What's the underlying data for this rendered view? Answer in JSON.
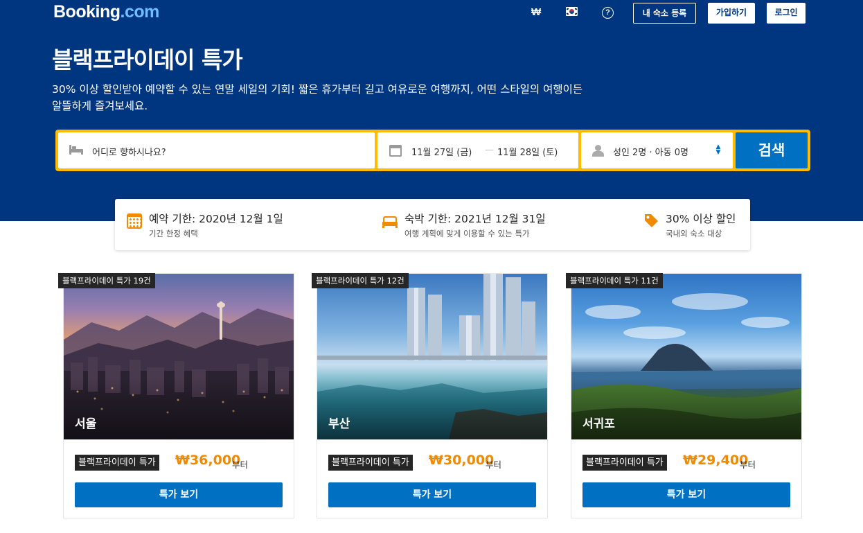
{
  "header": {
    "logo_main": "Booking",
    "logo_suffix": ".com",
    "currency": "₩",
    "help_glyph": "?",
    "list_property_label": "내 숙소 등록",
    "signup_label": "가입하기",
    "login_label": "로그인"
  },
  "hero": {
    "title": "블랙프라이데이 특가",
    "subtitle": "30% 이상 할인받아 예약할 수 있는 연말 세일의 기회! 짧은 휴가부터 길고 여유로운 여행까지, 어떤 스타일의 여행이든 알뜰하게 즐겨보세요."
  },
  "search": {
    "destination_placeholder": "어디로 향하시나요?",
    "checkin": "11월 27일 (금)",
    "date_separator": "—",
    "checkout": "11월 28일 (토)",
    "guests": "성인 2명 · 아동 0명",
    "search_label": "검색",
    "colors": {
      "border": "#febb02",
      "button": "#0071c2"
    }
  },
  "info": [
    {
      "icon": "calendar-icon",
      "title": "예약 기한: 2020년 12월 1일",
      "subtitle": "기간 한정 혜택"
    },
    {
      "icon": "bed-icon",
      "title": "숙박 기한: 2021년 12월 31일",
      "subtitle": "여행 계획에 맞게 이용할 수 있는 특가"
    },
    {
      "icon": "tag-icon",
      "title": "30% 이상 할인",
      "subtitle": "국내외 숙소 대상"
    }
  ],
  "cards": [
    {
      "badge": "블랙프라이데이 특가 19건",
      "city": "서울",
      "deal_label": "블랙프라이데이 특가",
      "price": "₩36,000",
      "from": "부터",
      "button": "특가 보기"
    },
    {
      "badge": "블랙프라이데이 특가 12건",
      "city": "부산",
      "deal_label": "블랙프라이데이 특가",
      "price": "₩30,000",
      "from": "부터",
      "button": "특가 보기"
    },
    {
      "badge": "블랙프라이데이 특가 11건",
      "city": "서귀포",
      "deal_label": "블랙프라이데이 특가",
      "price": "₩29,400",
      "from": "부터",
      "button": "특가 보기"
    }
  ],
  "colors": {
    "brand": "#003580",
    "accent": "#f08a00",
    "badge": "#262626"
  }
}
